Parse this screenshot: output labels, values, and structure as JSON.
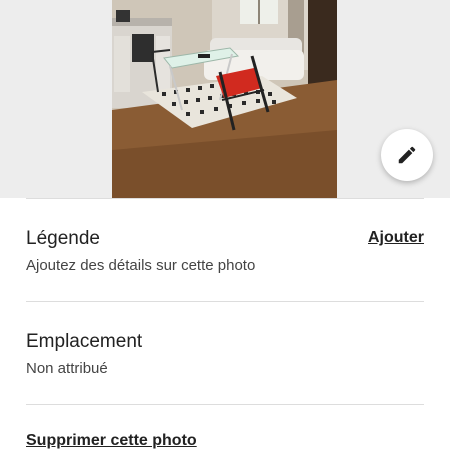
{
  "photo": {
    "description_icon": "edit-pencil-icon"
  },
  "caption": {
    "title": "Légende",
    "action": "Ajouter",
    "hint": "Ajoutez des détails sur cette photo"
  },
  "location": {
    "title": "Emplacement",
    "value": "Non attribué"
  },
  "delete": {
    "label": "Supprimer cette photo"
  },
  "colors": {
    "background": "#ffffff",
    "photo_backdrop": "#ededed",
    "text": "#222222",
    "divider": "#dddddd"
  }
}
